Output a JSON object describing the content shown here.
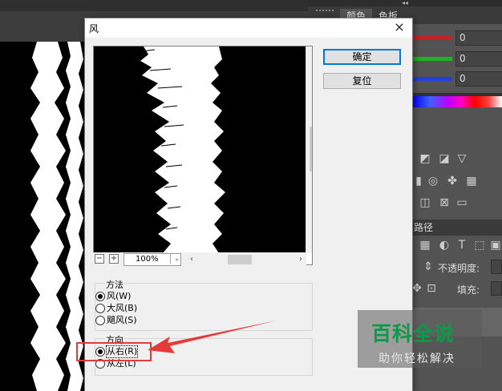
{
  "window": {
    "title": "风",
    "close_label": "×"
  },
  "preview": {
    "zoom_value": "100%",
    "zoom_out_label": "−",
    "zoom_in_label": "+"
  },
  "buttons": {
    "ok_label": "确定",
    "reset_label": "复位"
  },
  "method_group": {
    "label": "方法",
    "options": [
      {
        "label": "风(W)",
        "checked": true
      },
      {
        "label": "大风(B)",
        "checked": false
      },
      {
        "label": "飓风(S)",
        "checked": false
      }
    ]
  },
  "direction_group": {
    "label": "方向",
    "options": [
      {
        "label": "从右(R)",
        "checked": true
      },
      {
        "label": "从左(L)",
        "checked": false
      }
    ]
  },
  "side_panel": {
    "tabs": [
      "颜色",
      "色板"
    ],
    "sliders": [
      {
        "color": "#c82020",
        "value": "0"
      },
      {
        "color": "#20b020",
        "value": "0"
      },
      {
        "color": "#2040e0",
        "value": "0"
      }
    ],
    "paths_tab": "路径",
    "opacity_label": "不透明度:",
    "fill_label": "填充:"
  },
  "watermark": {
    "title": "百科全说",
    "subtitle": "助你轻松解决",
    "color": "#0d9a48"
  },
  "annotation": {
    "color": "#e53a3a"
  }
}
